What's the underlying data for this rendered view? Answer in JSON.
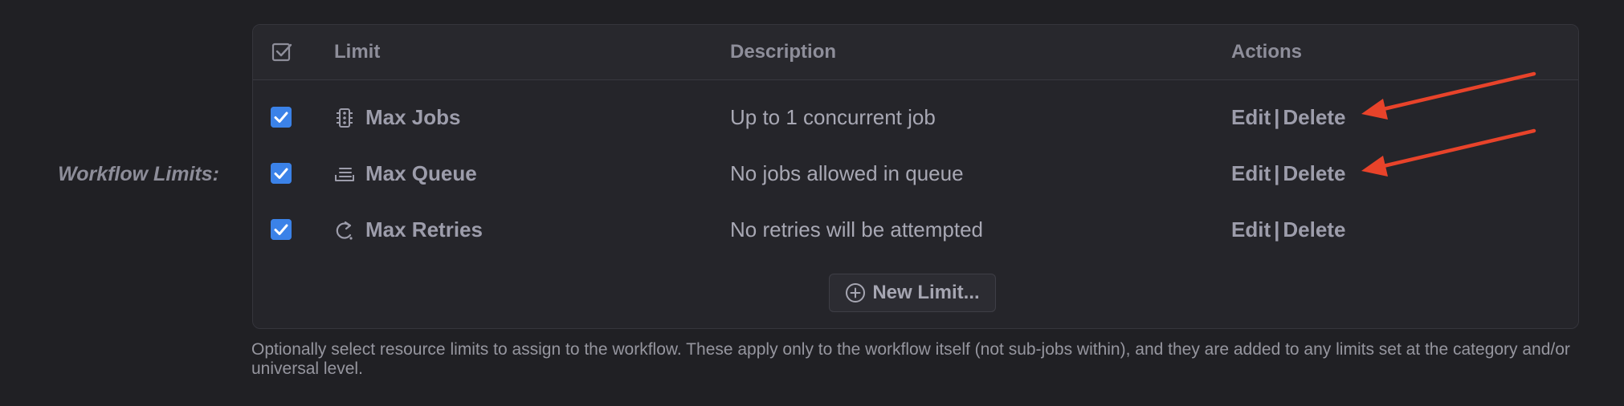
{
  "section": {
    "label": "Workflow Limits:"
  },
  "table": {
    "headers": {
      "limit": "Limit",
      "description": "Description",
      "actions": "Actions"
    },
    "rows": [
      {
        "name": "Max Jobs",
        "icon": "traffic-light-icon",
        "description": "Up to 1 concurrent job",
        "checked": true,
        "edit": "Edit",
        "separator": "|",
        "delete": "Delete"
      },
      {
        "name": "Max Queue",
        "icon": "queue-stack-icon",
        "description": "No jobs allowed in queue",
        "checked": true,
        "edit": "Edit",
        "separator": "|",
        "delete": "Delete"
      },
      {
        "name": "Max Retries",
        "icon": "retry-arrow-icon",
        "description": "No retries will be attempted",
        "checked": true,
        "edit": "Edit",
        "separator": "|",
        "delete": "Delete"
      }
    ],
    "new_button": {
      "label": "New Limit...",
      "icon": "plus-circle-icon"
    }
  },
  "help_text": "Optionally select resource limits to assign to the workflow. These apply only to the workflow itself (not sub-jobs within), and they are added to any limits set at the category and/or universal level.",
  "colors": {
    "background": "#202024",
    "checkbox": "#3b82e8",
    "annotation_arrow": "#e8432a"
  }
}
